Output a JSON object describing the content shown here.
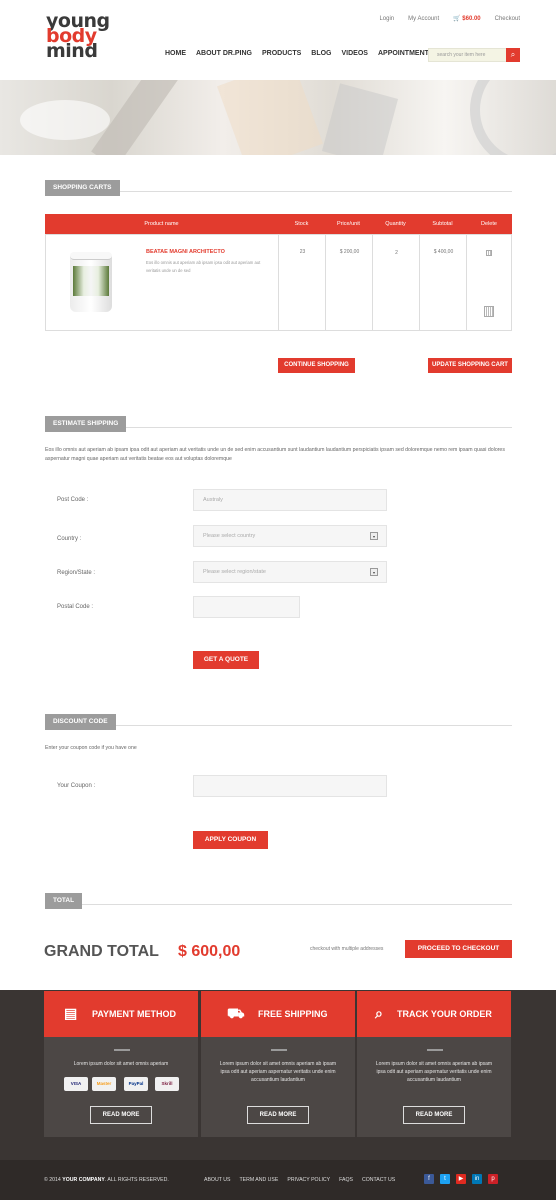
{
  "header": {
    "logo": {
      "line1": "young",
      "line2": "body",
      "line3": "mind"
    },
    "top_links": {
      "login": "Login",
      "account": "My Account",
      "cart_total": "$60.00",
      "checkout": "Checkout"
    },
    "nav": [
      "HOME",
      "ABOUT DR.PING",
      "PRODUCTS",
      "BLOG",
      "VIDEOS",
      "APPOINTMENT"
    ],
    "search_placeholder": "search your item here"
  },
  "cart": {
    "title": "SHOPPING CARTS",
    "columns": [
      "Product name",
      "Stock",
      "Price/unit",
      "Quantity",
      "Subtotal",
      "Delete"
    ],
    "row": {
      "name": "BEATAE MAGNI ARCHITECTO",
      "desc": "Eos illo omnis aut aperiam ab ipsam ipsa odit aut aperiam aut veritatis unde un de sed",
      "stock": "23",
      "price": "$ 200,00",
      "qty": "2",
      "subtotal": "$ 400,00"
    },
    "continue": "CONTINUE SHOPPING",
    "update": "UPDATE SHOPPING CART"
  },
  "shipping": {
    "title": "ESTIMATE SHIPPING",
    "text": "Eos illo omnis aut aperiam ab ipsam ipsa odit aut aperiam aut veritatis unde un de sed enim accusantium sunt laudantium  laudantium perspiciatis ipsam sed doloremque nemo rem ipsam quasi dolores aspernatur magni quae aperiam aut veritatis beatae eos aut voluptas doloremque",
    "post_label": "Post Code :",
    "post_value": "Australy",
    "country_label": "Country :",
    "country_placeholder": "Please select country",
    "region_label": "Region/State :",
    "region_placeholder": "Please select region/state",
    "postal_label": "Postal Code :",
    "quote_button": "GET A QUOTE"
  },
  "discount": {
    "title": "DISCOUNT CODE",
    "text": "Enter your coupon code if you have one",
    "coupon_label": "Your Coupon :",
    "apply_button": "APPLY COUPON"
  },
  "total": {
    "title": "TOTAL",
    "label": "GRAND TOTAL",
    "value": "$ 600,00",
    "multi": "checkout with multiple addresses",
    "checkout_button": "PROCEED TO CHECKOUT"
  },
  "footer": {
    "boxes": [
      {
        "title": "PAYMENT METHOD",
        "desc": "Lorem ipsum dolor sit amet  omnis aperiam",
        "button": "READ MORE",
        "cards": [
          "VISA",
          "Master",
          "PayPal",
          "Skrill"
        ]
      },
      {
        "title": "FREE SHIPPING",
        "desc": "Lorem ipsum dolor sit amet  omnis aperiam ab ipsam ipsa odit aut aperiam aspernatur veritatis unde enim accusantium laudantium",
        "button": "READ MORE"
      },
      {
        "title": "TRACK YOUR ORDER",
        "desc": "Lorem ipsum dolor sit amet  omnis aperiam ab ipsam ipsa odit aut aperiam aspernatur veritatis unde enim accusantium laudantium",
        "button": "READ MORE"
      }
    ],
    "copyright_pre": "© 2014",
    "company": "YOUR COMPANY",
    "copyright_post": ". ALL RIGHTS RESERVED.",
    "links": [
      "ABOUT US",
      "TERM AND USE",
      "PRIVACY POLICY",
      "FAQS",
      "CONTACT US"
    ],
    "social": [
      {
        "icon": "facebook-icon",
        "glyph": "f",
        "color": "#3b5998"
      },
      {
        "icon": "twitter-icon",
        "glyph": "t",
        "color": "#1da1f2"
      },
      {
        "icon": "youtube-icon",
        "glyph": "▶",
        "color": "#e02a20"
      },
      {
        "icon": "linkedin-icon",
        "glyph": "in",
        "color": "#0077b5"
      },
      {
        "icon": "pinterest-icon",
        "glyph": "p",
        "color": "#cb2027"
      }
    ]
  }
}
